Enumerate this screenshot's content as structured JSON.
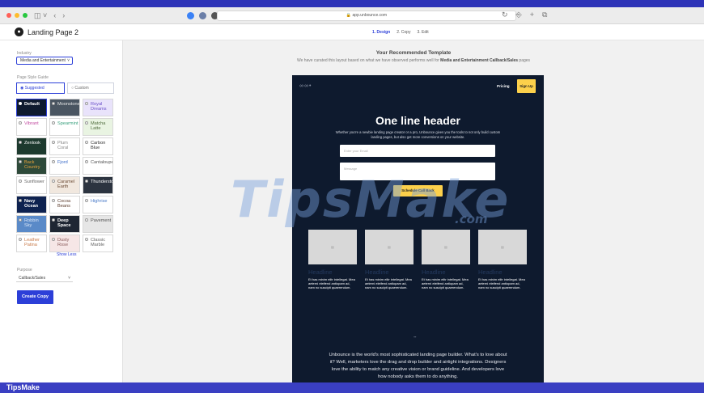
{
  "browser": {
    "url": "app.unbounce.com"
  },
  "app": {
    "title": "Landing Page 2",
    "steps": [
      {
        "label": "1. Design",
        "active": true
      },
      {
        "label": "2. Copy",
        "active": false
      },
      {
        "label": "3. Edit",
        "active": false
      }
    ]
  },
  "sidebar": {
    "industry_label": "Industry",
    "industry_value": "Media and Entertainment",
    "style_label": "Page Style Guide",
    "suggested_label": "Suggested",
    "custom_label": "Custom",
    "tiles": [
      {
        "label": "Default",
        "bg": "#0e1a2e",
        "fg": "#ffffff",
        "bold": true,
        "selected": true
      },
      {
        "label": "Moonstone",
        "bg": "#4a5561",
        "fg": "#e8e8e8"
      },
      {
        "label": "Royal Dreams",
        "bg": "#e9e3fb",
        "fg": "#6a4fc8"
      },
      {
        "label": "Vibrant",
        "bg": "#ffffff",
        "fg": "#c24aa0"
      },
      {
        "label": "Spearmint",
        "bg": "#ffffff",
        "fg": "#3aa17e"
      },
      {
        "label": "Matcha Latte",
        "bg": "#e9f4e2",
        "fg": "#4f6b3d"
      },
      {
        "label": "Zenlook",
        "bg": "#1d3a2e",
        "fg": "#ffffff"
      },
      {
        "label": "Plum Coral",
        "bg": "#ffffff",
        "fg": "#888888"
      },
      {
        "label": "Carbon Blue",
        "bg": "#ffffff",
        "fg": "#333333"
      },
      {
        "label": "Back Country",
        "bg": "#2e4a3a",
        "fg": "#e8a23a"
      },
      {
        "label": "Fjord",
        "bg": "#ffffff",
        "fg": "#3a6ac8"
      },
      {
        "label": "Cantaloupe",
        "bg": "#ffffff",
        "fg": "#555555"
      },
      {
        "label": "Sunflower",
        "bg": "#ffffff",
        "fg": "#666666"
      },
      {
        "label": "Caramel Earth",
        "bg": "#f1e8df",
        "fg": "#6a4a35"
      },
      {
        "label": "Thunderstorm",
        "bg": "#2c3440",
        "fg": "#ffffff"
      },
      {
        "label": "Navy Ocean",
        "bg": "#0e2250",
        "fg": "#ffffff",
        "bold": true
      },
      {
        "label": "Cocoa Beans",
        "bg": "#ffffff",
        "fg": "#5a3a2a"
      },
      {
        "label": "Highrise",
        "bg": "#ffffff",
        "fg": "#4a7ac8"
      },
      {
        "label": "Robbin Sky",
        "bg": "#5a8ac8",
        "fg": "#dce8f8"
      },
      {
        "label": "Deep Space",
        "bg": "#1e2633",
        "fg": "#ffffff",
        "bold": true
      },
      {
        "label": "Pavement",
        "bg": "#e6e6e6",
        "fg": "#555555"
      },
      {
        "label": "Leather Patina",
        "bg": "#ffffff",
        "fg": "#c87a4a"
      },
      {
        "label": "Dusty Rose",
        "bg": "#f6e6e6",
        "fg": "#8a5a5a"
      },
      {
        "label": "Classic Marble",
        "bg": "#ffffff",
        "fg": "#666666"
      }
    ],
    "show_less": "Show Less",
    "purpose_label": "Purpose",
    "purpose_value": "Callback/Sales",
    "create_button": "Create Copy"
  },
  "main": {
    "title": "Your Recommended Template",
    "subtitle_prefix": "We have curated this layout based on what we have observed performs well for ",
    "subtitle_bold": "Media and Entertainment Callback/Sales",
    "subtitle_suffix": " pages",
    "preview": {
      "logo": "∞∞•",
      "pricing": "Pricing",
      "signup": "Sign Up",
      "header": "One line header",
      "paragraph": "Whether you're a newbie landing page creator or a pro, Unbounce gives you the tools to not only build custom landing pages, but also get more conversions on your website.",
      "email_placeholder": "Enter your Email",
      "message_placeholder": "Message",
      "cta": "Schedule Call Back",
      "features": [
        {
          "headline": "Headline",
          "text": "Et has minim elitr intellegat. Mea aeterni eleifend antiopam ad, nam no suscipit quaerendum."
        },
        {
          "headline": "Headline",
          "text": "Et has minim elitr intellegat. Mea aeterni eleifend antiopam ad, nam no suscipit quaerendum."
        },
        {
          "headline": "Headline",
          "text": "Et has minim elitr intellegat. Mea aeterni eleifend antiopam ad, nam no suscipit quaerendum."
        },
        {
          "headline": "Headline",
          "text": "Et has minim elitr intellegat. Mea aeterni eleifend antiopam ad, nam no suscipit quaerendum."
        }
      ],
      "quote_mark": "“”",
      "bottom_text": "Unbounce is the world's most sophisticated landing page builder. What's to love about it? Well, marketers love the drag and drop builder and airtight integrations. Designers love the ability to match any creative vision or brand guideline. And developers love how nobody asks them to do anything."
    }
  },
  "watermark": {
    "main": "TipsMake",
    "suffix": ".com"
  },
  "footer": {
    "label": "TipsMake"
  }
}
